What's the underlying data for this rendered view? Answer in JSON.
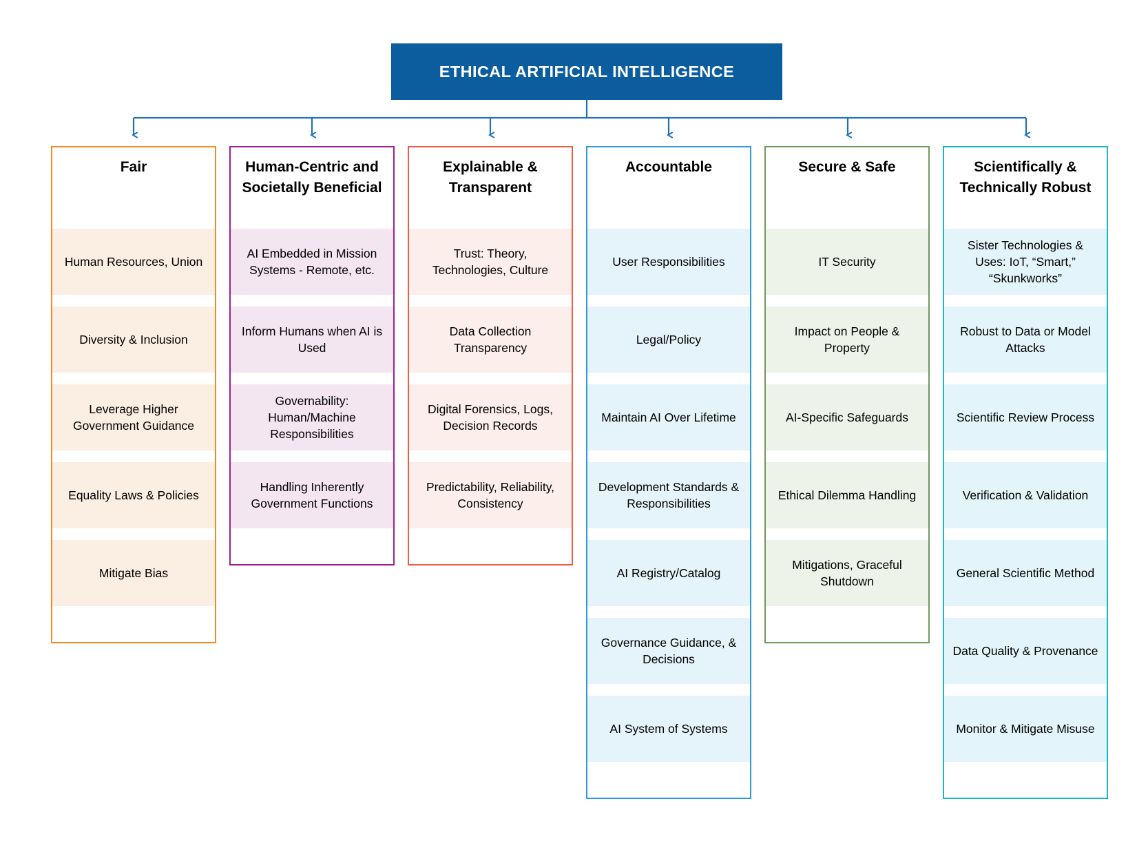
{
  "diagram": {
    "root": {
      "label": "ETHICAL ARTIFICIAL INTELLIGENCE",
      "color": "#0b5d9e",
      "text_color": "#ffffff"
    },
    "connector_color": "#1f72b5",
    "columns": [
      {
        "id": "fair",
        "header": "Fair",
        "border_color": "#ef8b22",
        "item_fill": "#fbeee2",
        "items": [
          "Human Resources, Union",
          "Diversity & Inclusion",
          "Leverage Higher Government Guidance",
          "Equality Laws & Policies",
          "Mitigate Bias"
        ]
      },
      {
        "id": "human-centric",
        "header": "Human-Centric and Societally Beneficial",
        "border_color": "#a01f92",
        "item_fill": "#f3e6f1",
        "items": [
          "AI Embedded in Mission Systems - Remote, etc.",
          "Inform Humans when AI is Used",
          "Governability: Human/Machine Responsibilities",
          "Handling Inherently Government Functions"
        ]
      },
      {
        "id": "explainable-transparent",
        "header": "Explainable & Transparent",
        "border_color": "#ef5b45",
        "item_fill": "#fceeea",
        "items": [
          "Trust: Theory, Technologies, Culture",
          "Data Collection Transparency",
          "Digital Forensics, Logs, Decision Records",
          "Predictability, Reliability, Consistency"
        ]
      },
      {
        "id": "accountable",
        "header": "Accountable",
        "border_color": "#2d9ada",
        "item_fill": "#e5f3fa",
        "items": [
          "User Responsibilities",
          "Legal/Policy",
          "Maintain AI Over Lifetime",
          "Development Standards & Responsibilities",
          "AI Registry/Catalog",
          "Governance Guidance, & Decisions",
          "AI System of Systems"
        ]
      },
      {
        "id": "secure-safe",
        "header": "Secure & Safe",
        "border_color": "#6d9a5a",
        "item_fill": "#eef3ea",
        "items": [
          "IT Security",
          "Impact on People & Property",
          "AI-Specific Safeguards",
          "Ethical Dilemma Handling",
          "Mitigations, Graceful Shutdown"
        ]
      },
      {
        "id": "scientifically-technically-robust",
        "header": "Scientifically & Technically Robust",
        "border_color": "#19b6c9",
        "item_fill": "#e3f4fa",
        "items": [
          "Sister Technologies & Uses: IoT, “Smart,” “Skunkworks”",
          "Robust to Data or Model Attacks",
          "Scientific Review Process",
          "Verification & Validation",
          "General Scientific Method",
          "Data Quality & Provenance",
          "Monitor & Mitigate Misuse"
        ]
      }
    ]
  }
}
